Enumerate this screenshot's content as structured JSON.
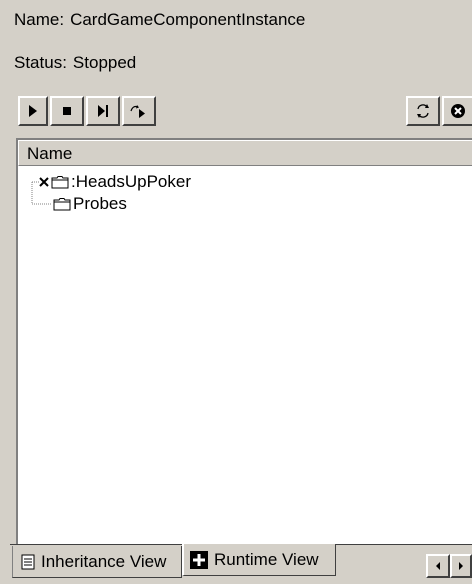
{
  "info": {
    "name_label": "Name:",
    "name_value": "CardGameComponentInstance",
    "status_label": "Status:",
    "status_value": "Stopped"
  },
  "toolbar": {
    "buttons": [
      {
        "name": "play-button",
        "icon": "play-icon"
      },
      {
        "name": "stop-button",
        "icon": "stop-icon"
      },
      {
        "name": "step-button",
        "icon": "step-icon"
      },
      {
        "name": "step-over-button",
        "icon": "step-over-icon"
      },
      {
        "name": "refresh-button",
        "icon": "refresh-icon"
      },
      {
        "name": "close-button",
        "icon": "close-circle-icon"
      }
    ]
  },
  "tree": {
    "column_header": "Name",
    "items": [
      {
        "label": ":HeadsUpPoker",
        "icon": "folder-icon",
        "marker": "x-mark-icon"
      },
      {
        "label": "Probes",
        "icon": "folder-icon"
      }
    ]
  },
  "tabs": [
    {
      "label": "Inheritance View",
      "icon": "list-icon",
      "active": false
    },
    {
      "label": "Runtime View",
      "icon": "plus-box-icon",
      "active": true
    }
  ],
  "scroll_controls": [
    "scroll-left-icon",
    "scroll-right-icon"
  ]
}
